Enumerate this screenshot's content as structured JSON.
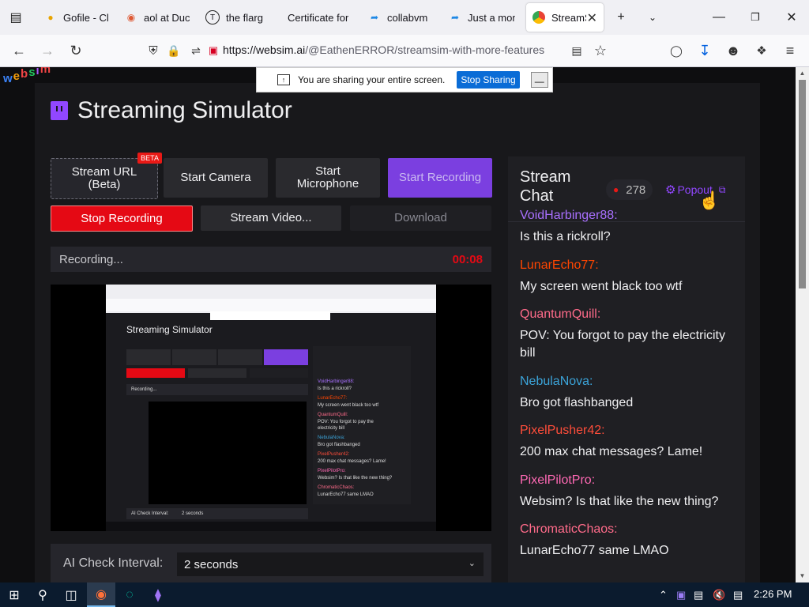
{
  "browser": {
    "tabs": [
      {
        "label": "Gofile - Clo",
        "icon": "folder-icon"
      },
      {
        "label": "aol at Duck",
        "icon": "duckduckgo-icon"
      },
      {
        "label": "the flarg",
        "icon": "t-icon"
      },
      {
        "label": "Certificate for",
        "icon": "none"
      },
      {
        "label": "collabvm",
        "icon": "collabvm-icon"
      },
      {
        "label": "Just a mom",
        "icon": "collabvm-icon"
      },
      {
        "label": "StreamS",
        "icon": "chrome-icon",
        "active": true
      }
    ],
    "url_host": "https://websim.ai",
    "url_path": "/@EathenERROR/streamsim-with-more-features"
  },
  "share_bar": {
    "text": "You are sharing your entire screen.",
    "stop_label": "Stop Sharing",
    "minimize_label": "—"
  },
  "logo": {
    "letters": [
      "w",
      "e",
      "b",
      "s",
      "i",
      "m"
    ]
  },
  "app": {
    "title": "Streaming Simulator",
    "buttons": {
      "stream_url": "Stream URL (Beta)",
      "beta_badge": "BETA",
      "start_camera": "Start Camera",
      "start_microphone": "Start Microphone",
      "start_recording": "Start Recording",
      "stop_recording": "Stop Recording",
      "stream_video": "Stream Video...",
      "download": "Download"
    },
    "status": {
      "text": "Recording...",
      "timer": "00:08"
    },
    "ai_check": {
      "label": "AI Check Interval:",
      "value": "2 seconds"
    }
  },
  "chat": {
    "title": "Stream Chat",
    "viewers": "278",
    "popout_label": "Popout",
    "messages": [
      {
        "user": "VoidHarbinger88:",
        "text": "Is this a rickroll?",
        "color": "#a970ff"
      },
      {
        "user": "LunarEcho77:",
        "text": "My screen went black too wtf",
        "color": "#ff4500"
      },
      {
        "user": "QuantumQuill:",
        "text": "POV: You forgot to pay the electricity bill",
        "color": "#ff6b8a"
      },
      {
        "user": "NebulaNova:",
        "text": "Bro got flashbanged",
        "color": "#3ba3d8"
      },
      {
        "user": "PixelPusher42:",
        "text": "200 max chat messages? Lame!",
        "color": "#ff4d3a"
      },
      {
        "user": "PixelPilotPro:",
        "text": "Websim? Is that like the new thing?",
        "color": "#ff69b4"
      },
      {
        "user": "ChromaticChaos:",
        "text": "LunarEcho77 same LMAO",
        "color": "#ff6b8a"
      }
    ]
  },
  "preview_mini": {
    "title": "Streaming Simulator",
    "status": "Recording...",
    "ai_label": "AI Check Interval:",
    "ai_value": "2 seconds",
    "chat_lines": [
      "VoidHarbinger88:",
      "Is this a rickroll?",
      "LunarEcho77:",
      "My screen went black too wtf",
      "QuantumQuill:",
      "POV: You forgot to pay the",
      "electricity bill",
      "NebulaNova:",
      "Bro got flashbanged",
      "PixelPusher42:",
      "200 max chat messages? Lame!",
      "PixelPilotPro:",
      "Websim? Is that like the new thing?",
      "ChromaticChaos:",
      "LunarEcho77 same LMAO"
    ]
  },
  "taskbar": {
    "time": "2:26 PM"
  }
}
